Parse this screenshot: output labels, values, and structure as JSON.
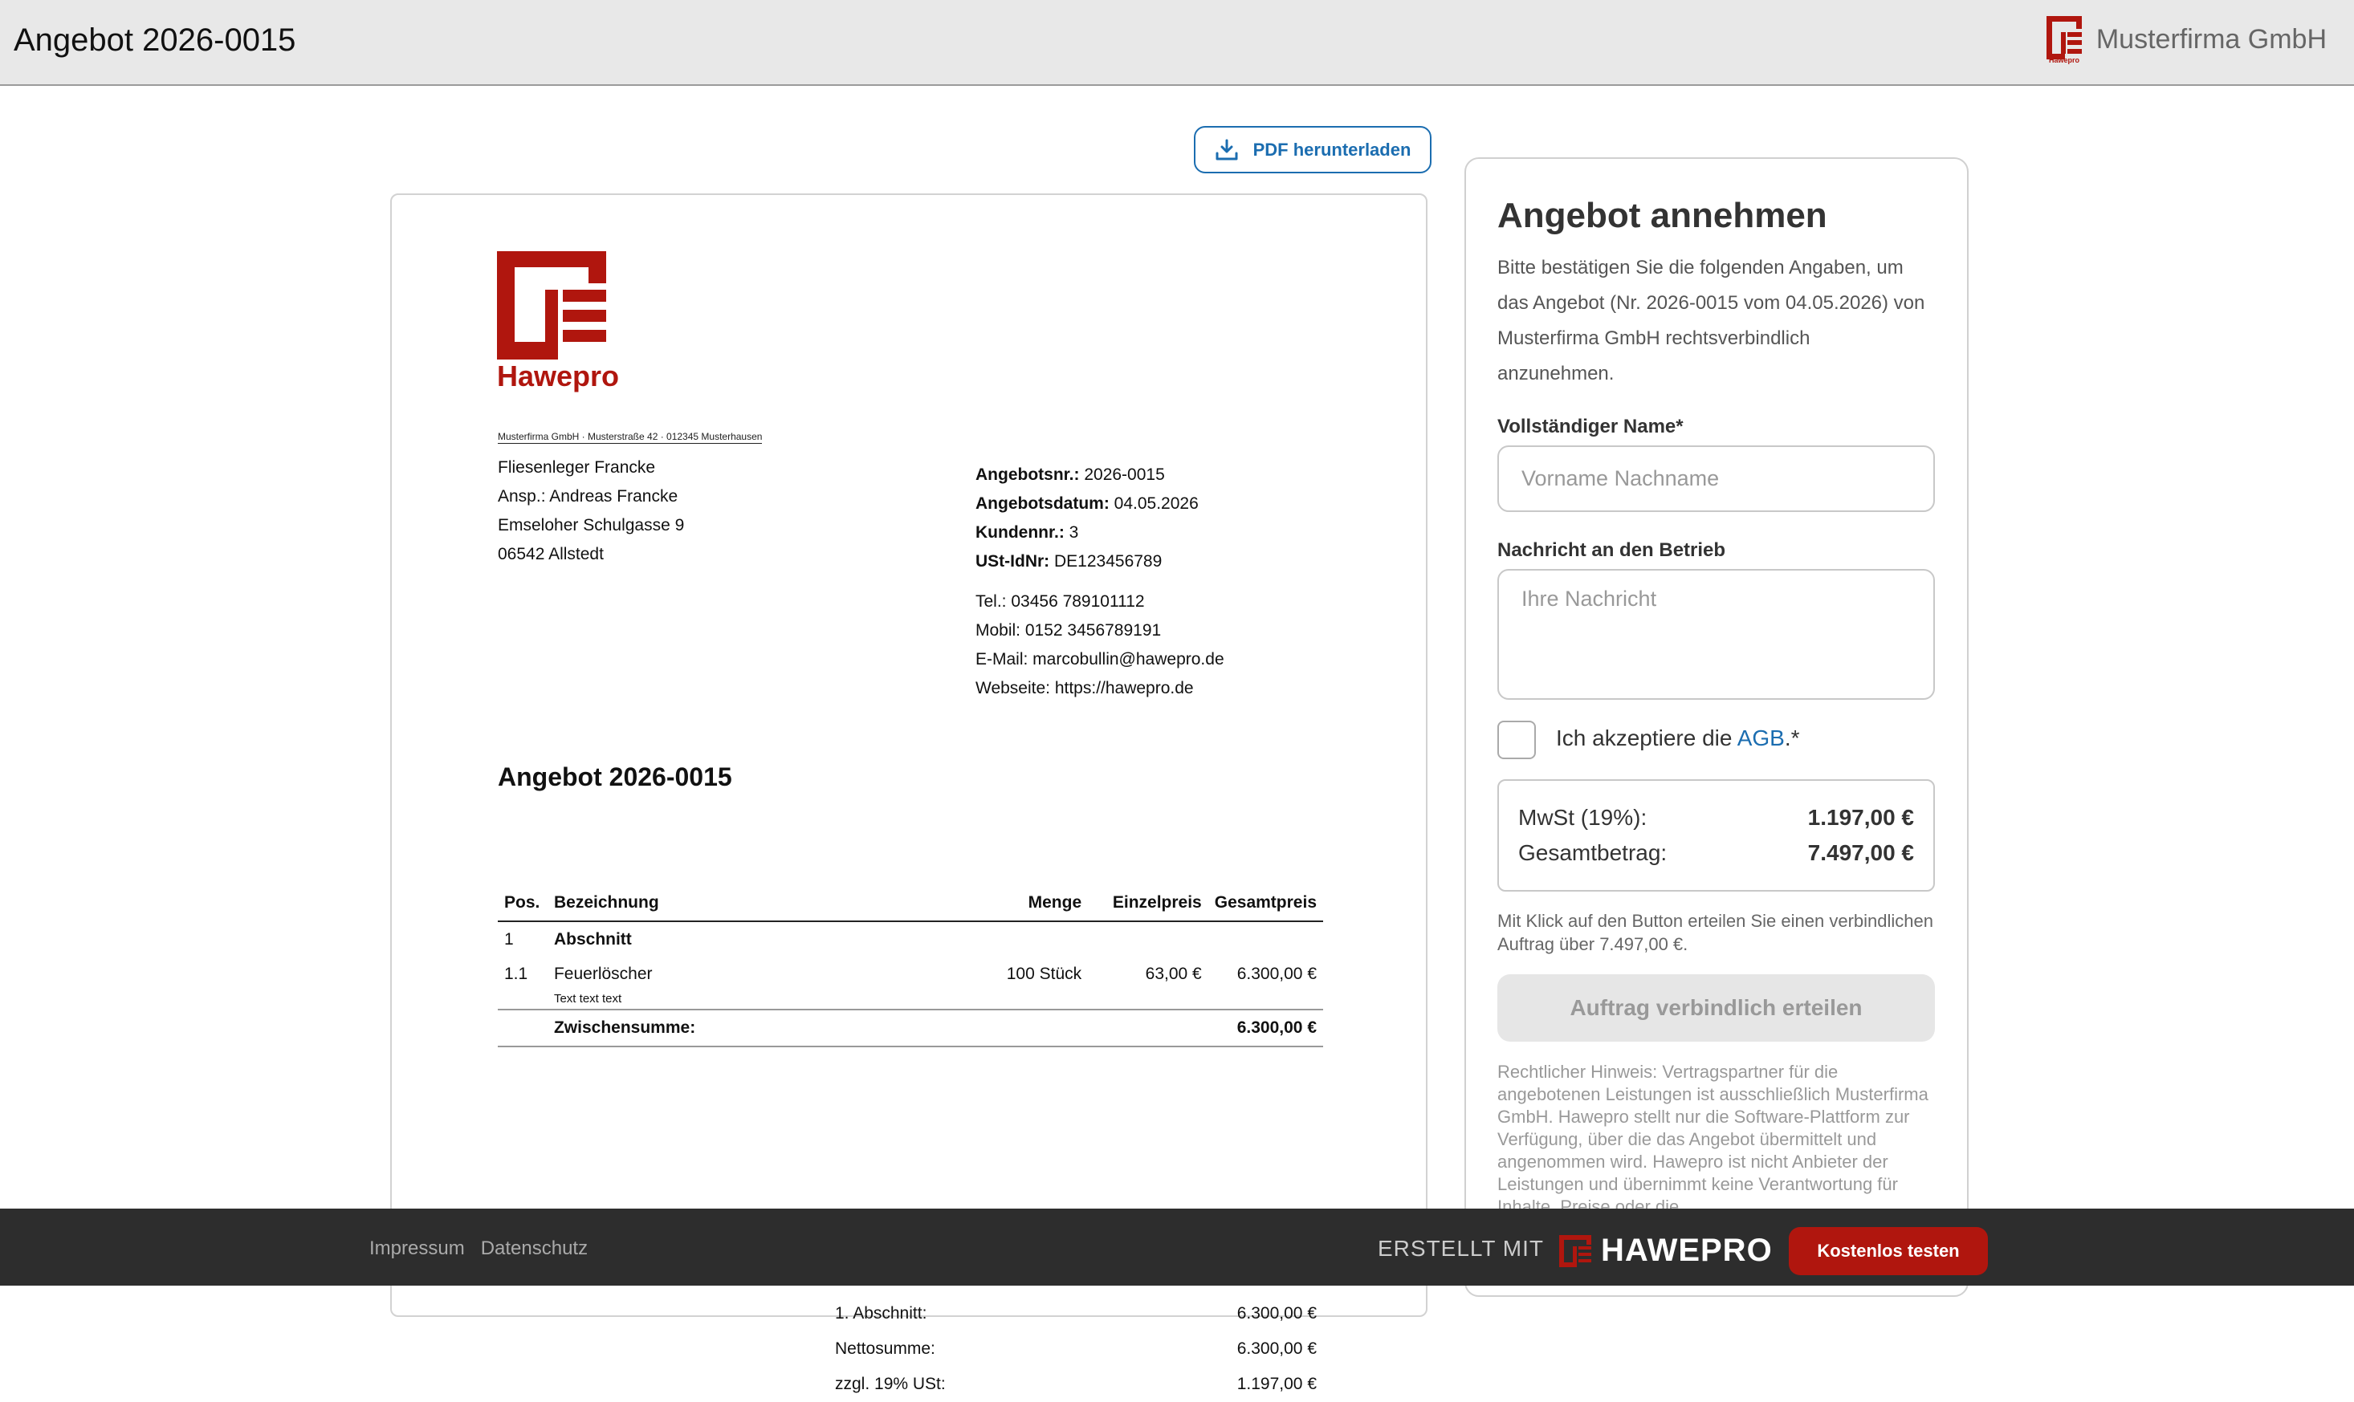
{
  "header": {
    "title": "Angebot 2026-0015",
    "brand_name": "Musterfirma GmbH",
    "brand_logo_caption": "Hawepro"
  },
  "actions": {
    "pdf_label": "PDF herunterladen"
  },
  "document": {
    "logo_word": "Hawepro",
    "sender_line": "Musterfirma GmbH · Musterstraße 42 · 012345 Musterhausen",
    "recipient": [
      "Fliesenleger Francke",
      "Ansp.: Andreas Francke",
      "Emseloher Schulgasse 9",
      "06542 Allstedt"
    ],
    "meta": [
      {
        "label": "Angebotsnr.:",
        "value": "2026-0015"
      },
      {
        "label": "Angebotsdatum:",
        "value": "04.05.2026"
      },
      {
        "label": "Kundennr.:",
        "value": "3"
      },
      {
        "label": "USt-IdNr:",
        "value": "DE123456789"
      }
    ],
    "contact": [
      "Tel.: 03456 789101112",
      "Mobil: 0152 3456789191",
      "E-Mail: marcobullin@hawepro.de",
      "Webseite: https://hawepro.de"
    ],
    "title": "Angebot 2026-0015",
    "table": {
      "headers": {
        "pos": "Pos.",
        "desc": "Bezeichnung",
        "qty": "Menge",
        "unit": "Einzelpreis",
        "total": "Gesamtpreis"
      },
      "section": {
        "pos": "1",
        "desc": "Abschnitt"
      },
      "item": {
        "pos": "1.1",
        "desc": "Feuerlöscher",
        "note": "Text text text",
        "qty": "100 Stück",
        "unit": "63,00 €",
        "total": "6.300,00 €"
      },
      "subtotal": {
        "label": "Zwischensumme:",
        "value": "6.300,00 €"
      }
    },
    "totals": [
      {
        "label": "1. Abschnitt:",
        "value": "6.300,00 €"
      },
      {
        "label": "Nettosumme:",
        "value": "6.300,00 €"
      },
      {
        "label": "zzgl. 19% USt:",
        "value": "1.197,00 €"
      }
    ]
  },
  "panel": {
    "title": "Angebot annehmen",
    "intro": "Bitte bestätigen Sie die folgenden Angaben, um das Angebot (Nr. 2026-0015 vom 04.05.2026) von Musterfirma GmbH rechtsverbindlich anzunehmen.",
    "name_label": "Vollständiger Name*",
    "name_placeholder": "Vorname Nachname",
    "message_label": "Nachricht an den Betrieb",
    "message_placeholder": "Ihre Nachricht",
    "agb_prefix": "Ich akzeptiere die ",
    "agb_link": "AGB",
    "agb_suffix": ".*",
    "vat_label": "MwSt (19%):",
    "vat_value": "1.197,00 €",
    "total_label": "Gesamtbetrag:",
    "total_value": "7.497,00 €",
    "notice": "Mit Klick auf den Button erteilen Sie einen verbindlichen Auftrag über 7.497,00 €.",
    "submit_label": "Auftrag verbindlich erteilen",
    "legal": "Rechtlicher Hinweis: Vertragspartner für die angebotenen Leistungen ist ausschließlich Musterfirma GmbH. Hawepro stellt nur die Software-Plattform zur Verfügung, über die das Angebot übermittelt und angenommen wird. Hawepro ist nicht Anbieter der Leistungen und übernimmt keine Verantwortung für Inhalte, Preise oder die"
  },
  "footer": {
    "impressum": "Impressum",
    "datenschutz": "Datenschutz",
    "made_with": "ERSTELLT MIT",
    "brand": "HAWEPRO",
    "cta": "Kostenlos testen"
  },
  "colors": {
    "brand_red": "#b0160e",
    "link_blue": "#1b6db0",
    "footer_bg": "#2d2d2d"
  }
}
